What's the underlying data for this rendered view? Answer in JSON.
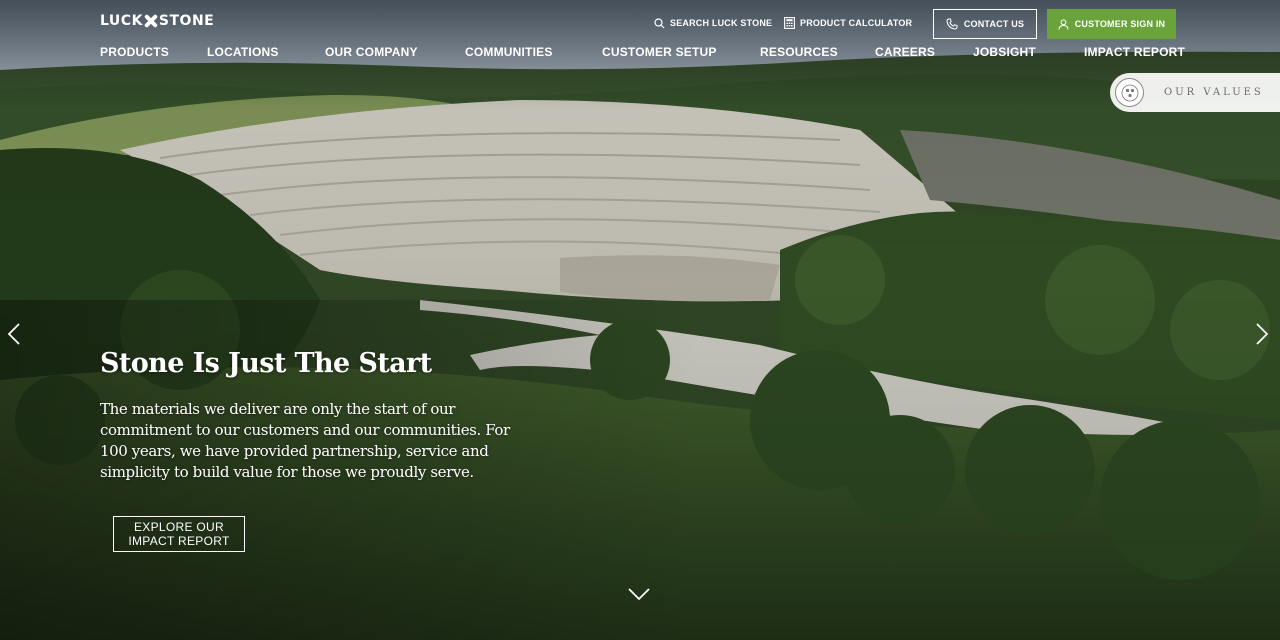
{
  "brand": {
    "logo_left": "LUCK",
    "logo_right": "STONE"
  },
  "utility": {
    "search_label": "SEARCH LUCK STONE",
    "calculator_label": "PRODUCT CALCULATOR",
    "contact_label": "CONTACT US",
    "signin_label": "CUSTOMER SIGN IN"
  },
  "nav": {
    "items": [
      {
        "label": "PRODUCTS"
      },
      {
        "label": "LOCATIONS"
      },
      {
        "label": "OUR COMPANY"
      },
      {
        "label": "COMMUNITIES"
      },
      {
        "label": "CUSTOMER SETUP"
      },
      {
        "label": "RESOURCES"
      },
      {
        "label": "CAREERS"
      },
      {
        "label": "JOBSIGHT"
      },
      {
        "label": "IMPACT REPORT"
      }
    ]
  },
  "values_tab": {
    "label": "OUR VALUES"
  },
  "hero": {
    "title": "Stone Is Just The Start",
    "body": "The materials we deliver are only the start of our commitment to our customers and our communities. For 100 years, we have provided partnership, service and simplicity to build value for those we proudly serve.",
    "cta_line1": "EXPLORE OUR",
    "cta_line2": "IMPACT REPORT"
  },
  "colors": {
    "accent_green": "#6aa33b",
    "text": "#ffffff",
    "values_text": "#6b6b6b"
  },
  "icons": [
    "search-icon",
    "calculator-icon",
    "phone-icon",
    "user-icon",
    "values-badge-icon",
    "chevron-left-icon",
    "chevron-right-icon",
    "chevron-down-icon"
  ]
}
